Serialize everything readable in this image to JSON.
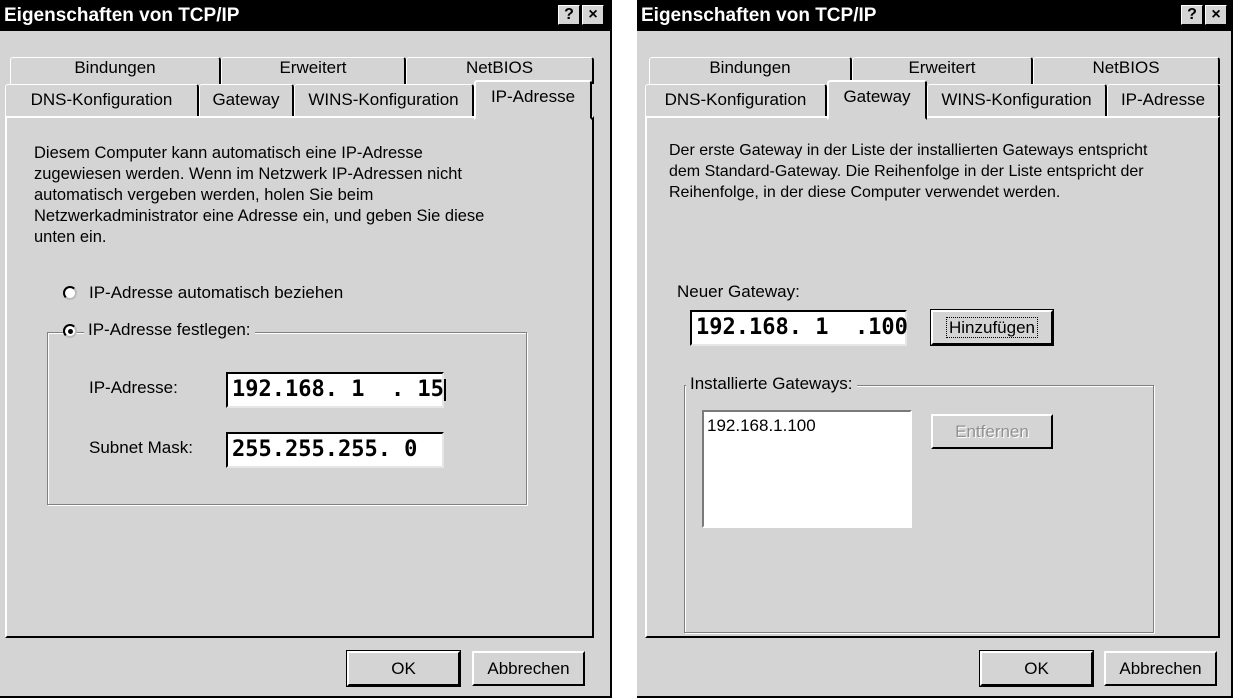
{
  "left_dialog": {
    "title": "Eigenschaften von TCP/IP",
    "help_button": "?",
    "close_button": "×",
    "tabs_back": [
      "Bindungen",
      "Erweitert",
      "NetBIOS"
    ],
    "tabs_front": [
      "DNS-Konfiguration",
      "Gateway",
      "WINS-Konfiguration",
      "IP-Adresse"
    ],
    "selected_tab": "IP-Adresse",
    "description": "Diesem Computer kann automatisch eine IP-Adresse zugewiesen werden. Wenn im Netzwerk IP-Adressen nicht automatisch vergeben werden, holen Sie beim Netzwerkadministrator eine Adresse ein, und geben Sie diese unten ein.",
    "radio_auto": "IP-Adresse automatisch beziehen",
    "radio_fixed": "IP-Adresse festlegen:",
    "selected_radio": "IP-Adresse festlegen:",
    "ip_label": "IP-Adresse:",
    "ip_value": "192.168. 1  . 15",
    "subnet_label": "Subnet Mask:",
    "subnet_value": "255.255.255. 0",
    "ok": "OK",
    "cancel": "Abbrechen"
  },
  "right_dialog": {
    "title": "Eigenschaften von TCP/IP",
    "help_button": "?",
    "close_button": "×",
    "tabs_back": [
      "Bindungen",
      "Erweitert",
      "NetBIOS"
    ],
    "tabs_front": [
      "DNS-Konfiguration",
      "Gateway",
      "WINS-Konfiguration",
      "IP-Adresse"
    ],
    "selected_tab": "Gateway",
    "description": "Der erste Gateway in der Liste der installierten Gateways entspricht dem Standard-Gateway. Die Reihenfolge in der Liste entspricht der Reihenfolge, in der diese Computer verwendet werden.",
    "new_gateway_label": "Neuer Gateway:",
    "new_gateway_value": "192.168. 1  .100",
    "add_button": "Hinzufügen",
    "installed_label": "Installierte Gateways:",
    "installed_list": [
      "192.168.1.100"
    ],
    "remove_button": "Entfernen",
    "ok": "OK",
    "cancel": "Abbrechen"
  }
}
